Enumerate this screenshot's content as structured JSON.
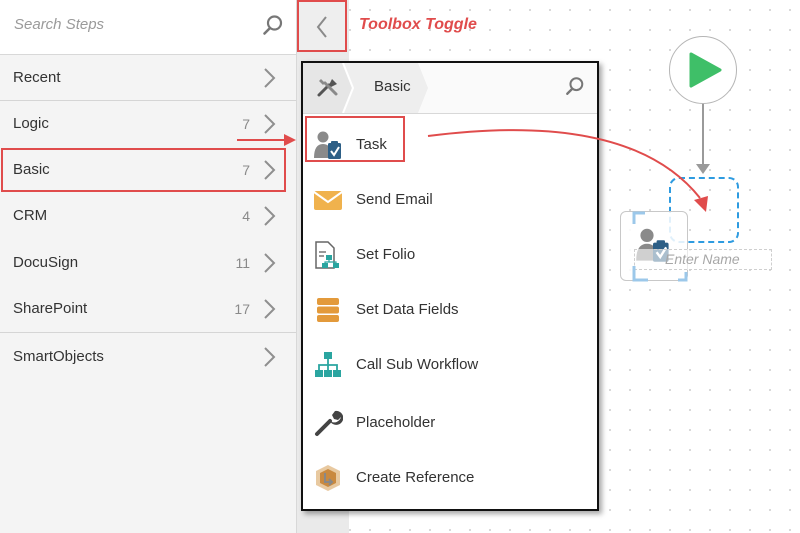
{
  "search": {
    "placeholder": "Search Steps"
  },
  "categories": [
    {
      "label": "Recent",
      "count": ""
    },
    {
      "label": "Logic",
      "count": "7"
    },
    {
      "label": "Basic",
      "count": "7"
    },
    {
      "label": "CRM",
      "count": "4"
    },
    {
      "label": "DocuSign",
      "count": "11"
    },
    {
      "label": "SharePoint",
      "count": "17"
    },
    {
      "label": "SmartObjects",
      "count": ""
    }
  ],
  "annotation": {
    "toggle_label": "Toolbox Toggle"
  },
  "steps_panel": {
    "breadcrumb": "Basic",
    "items": [
      {
        "label": "Task",
        "icon": "task-icon"
      },
      {
        "label": "Send Email",
        "icon": "email-icon"
      },
      {
        "label": "Set Folio",
        "icon": "set-folio-icon"
      },
      {
        "label": "Set Data Fields",
        "icon": "data-fields-icon"
      },
      {
        "label": "Call Sub Workflow",
        "icon": "sub-workflow-icon"
      },
      {
        "label": "Placeholder",
        "icon": "wrench-icon"
      },
      {
        "label": "Create Reference",
        "icon": "create-reference-icon"
      }
    ]
  },
  "designer": {
    "name_placeholder": "Enter Name"
  },
  "colors": {
    "highlight": "#e04c4c",
    "start_green": "#3fbf68",
    "drop_blue": "#2e9be0"
  }
}
